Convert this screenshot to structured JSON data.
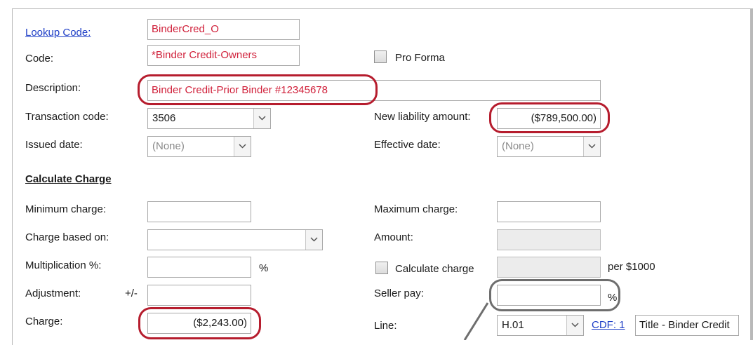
{
  "fields": {
    "lookup_code": {
      "label": "Lookup Code:",
      "value": "BinderCred_O"
    },
    "code": {
      "label": "Code:",
      "value": "*Binder Credit-Owners"
    },
    "pro_forma": {
      "label": "Pro Forma",
      "checked": false
    },
    "description": {
      "label": "Description:",
      "value": "Binder Credit-Prior Binder #12345678"
    },
    "transaction_code": {
      "label": "Transaction code:",
      "value": "3506"
    },
    "new_liability_amount": {
      "label": "New liability amount:",
      "value": "($789,500.00)"
    },
    "issued_date": {
      "label": "Issued date:",
      "value": "(None)"
    },
    "effective_date": {
      "label": "Effective date:",
      "value": "(None)"
    }
  },
  "calculate_charge": {
    "heading": "Calculate Charge",
    "minimum_charge": {
      "label": "Minimum charge:",
      "value": ""
    },
    "maximum_charge": {
      "label": "Maximum charge:",
      "value": ""
    },
    "charge_based_on": {
      "label": "Charge based on:",
      "value": ""
    },
    "amount": {
      "label": "Amount:",
      "value": ""
    },
    "multiplication": {
      "label": "Multiplication %:",
      "value": "",
      "suffix": "%"
    },
    "calculate_charge_check": {
      "label": "Calculate charge",
      "checked": false
    },
    "per_label": "per $1000",
    "adjustment": {
      "label": "Adjustment:",
      "sign": "+/-",
      "value": ""
    },
    "seller_pay": {
      "label": "Seller pay:",
      "value": "",
      "suffix": "%"
    },
    "charge": {
      "label": "Charge:",
      "value": "($2,243.00)"
    },
    "line": {
      "label": "Line:",
      "value": "H.01",
      "cdf_link": "CDF: 1",
      "title_value": "Title - Binder Credit"
    }
  },
  "colors": {
    "link": "#1f3fc7",
    "value_red": "#d0203a",
    "highlight_ring": "#b61d2e",
    "callout_ring": "#6e6e6e"
  }
}
